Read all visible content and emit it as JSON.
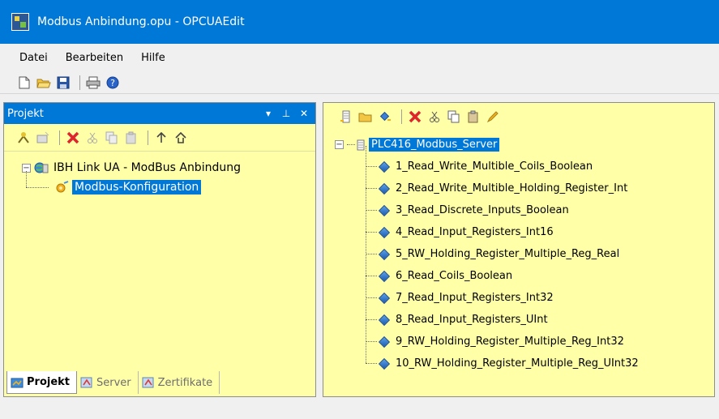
{
  "window": {
    "title": "Modbus Anbindung.opu - OPCUAEdit"
  },
  "menu": {
    "items": [
      "Datei",
      "Bearbeiten",
      "Hilfe"
    ]
  },
  "toolbar": {
    "icons": [
      "new-icon",
      "open-icon",
      "save-icon",
      "print-icon",
      "help-icon"
    ]
  },
  "project_pane": {
    "title": "Projekt",
    "header_buttons": [
      "▾",
      "⊥",
      "✕"
    ],
    "tree": {
      "root": "IBH Link UA - ModBus Anbindung",
      "child": "Modbus-Konfiguration"
    },
    "tabs": [
      "Projekt",
      "Server",
      "Zertifikate"
    ]
  },
  "server_pane": {
    "root": "PLC416_Modbus_Server",
    "items": [
      "1_Read_Write_Multible_Coils_Boolean",
      "2_Read_Write_Multible_Holding_Register_Int",
      "3_Read_Discrete_Inputs_Boolean",
      "4_Read_Input_Registers_Int16",
      "5_RW_Holding_Register_Multiple_Reg_Real",
      "6_Read_Coils_Boolean",
      "7_Read_Input_Registers_Int32",
      "8_Read_Input_Registers_UInt",
      "9_RW_Holding_Register_Multiple_Reg_Int32",
      "10_RW_Holding_Register_Multiple_Reg_UInt32"
    ]
  },
  "colors": {
    "titlebar": "#0078d7",
    "selection": "#0078d7",
    "pane_bg": "#ffffa8"
  }
}
